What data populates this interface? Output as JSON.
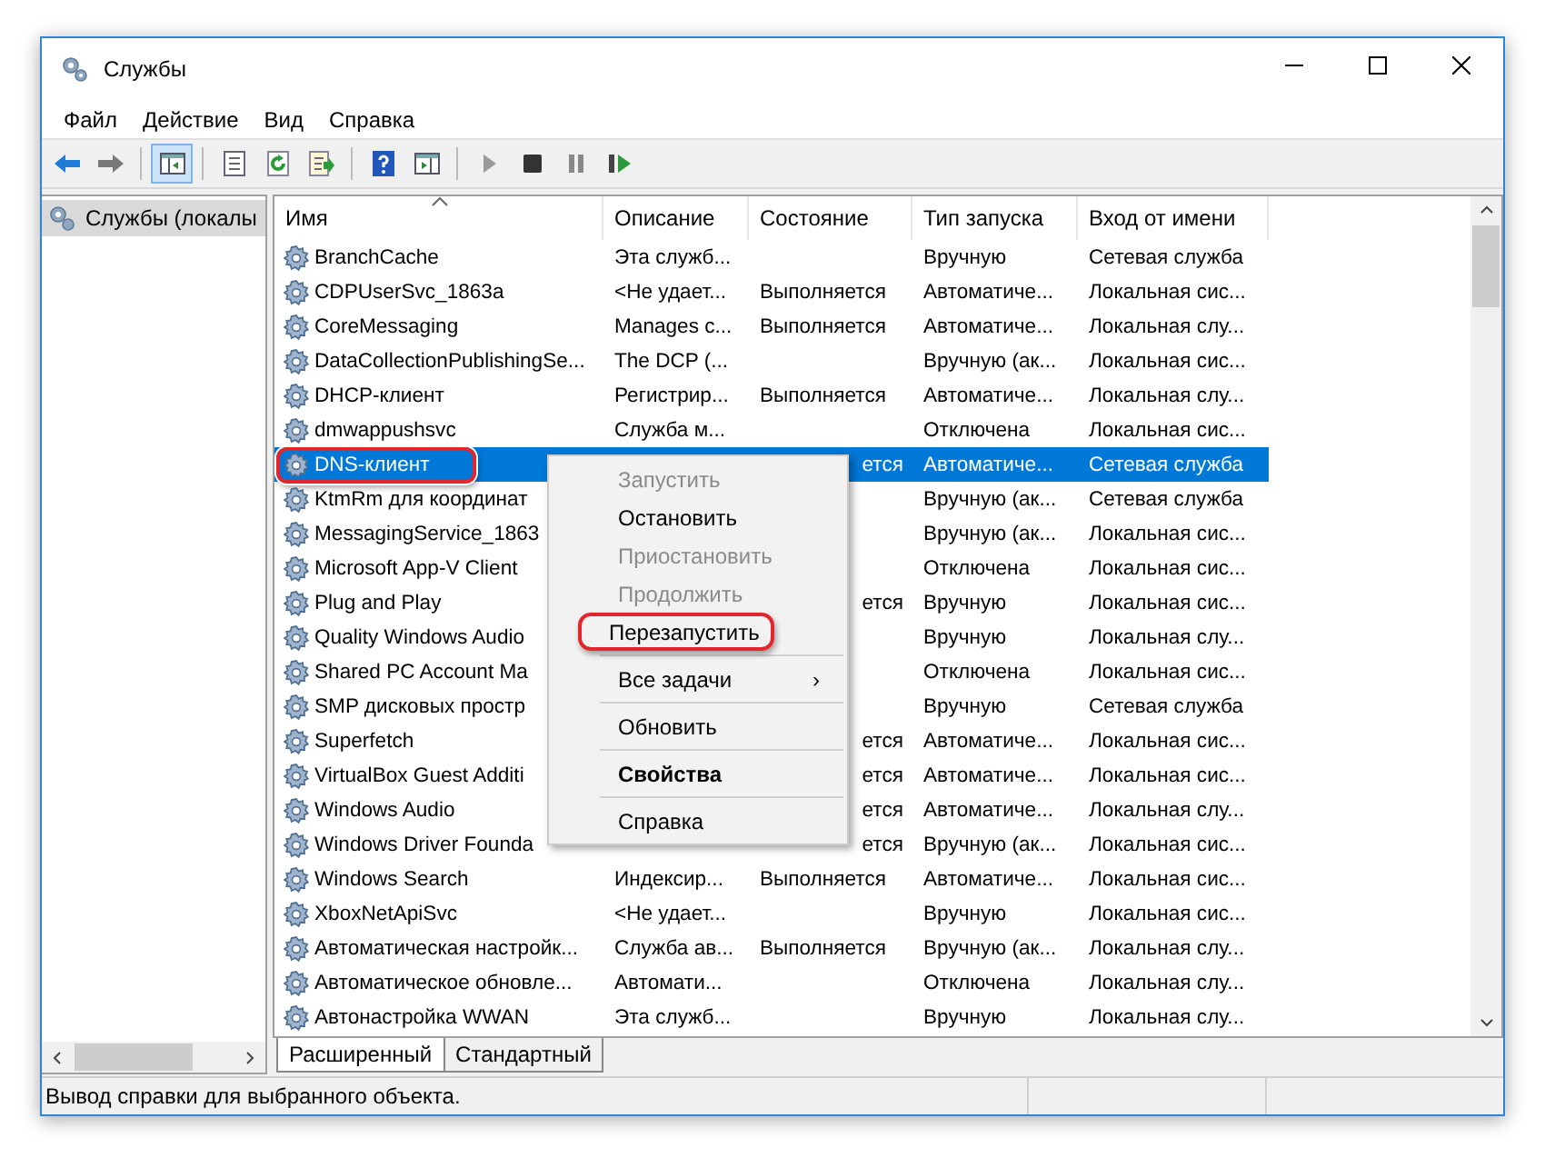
{
  "window": {
    "title": "Службы"
  },
  "menu": [
    "Файл",
    "Действие",
    "Вид",
    "Справка"
  ],
  "toolbar": [
    {
      "buttons": [
        {
          "kind": "back",
          "pressed": false
        },
        {
          "kind": "forward",
          "pressed": false
        }
      ]
    },
    {
      "buttons": [
        {
          "kind": "console-tree",
          "pressed": true
        }
      ]
    },
    {
      "buttons": [
        {
          "kind": "properties",
          "pressed": false
        },
        {
          "kind": "refresh",
          "pressed": false
        },
        {
          "kind": "export",
          "pressed": false
        }
      ]
    },
    {
      "buttons": [
        {
          "kind": "help",
          "pressed": false
        },
        {
          "kind": "action-pane",
          "pressed": false
        }
      ]
    },
    {
      "buttons": [
        {
          "kind": "play",
          "pressed": false
        },
        {
          "kind": "stop",
          "pressed": false
        },
        {
          "kind": "pause",
          "pressed": false
        },
        {
          "kind": "restart",
          "pressed": false
        }
      ]
    }
  ],
  "tree": {
    "items": [
      {
        "label": "Службы (локалы",
        "selected": true
      }
    ]
  },
  "table": {
    "columns": [
      "Имя",
      "Описание",
      "Состояние",
      "Тип запуска",
      "Вход от имени"
    ],
    "rows": [
      {
        "name": "BranchCache",
        "description": "Эта служб...",
        "startup": "Вручную",
        "logon": "Сетевая служба",
        "selected": false,
        "marked": false
      },
      {
        "name": "CDPUserSvc_1863a",
        "description": "<Не удает...",
        "state": "Выполняется",
        "startup": "Автоматиче...",
        "logon": "Локальная сис...",
        "selected": false,
        "covered": false,
        "marked": false
      },
      {
        "name": "CoreMessaging",
        "description": "Manages c...",
        "state": "Выполняется",
        "startup": "Автоматиче...",
        "logon": "Локальная слу...",
        "selected": false,
        "covered": false,
        "marked": false
      },
      {
        "name": "DataCollectionPublishingSe...",
        "description": "The DCP (...",
        "startup": "Вручную (ак...",
        "logon": "Локальная сис...",
        "selected": false,
        "marked": false
      },
      {
        "name": "DHCP-клиент",
        "description": "Регистрир...",
        "state": "Выполняется",
        "startup": "Автоматиче...",
        "logon": "Локальная слу...",
        "selected": false,
        "covered": false,
        "marked": false
      },
      {
        "name": "dmwappushsvc",
        "description": "Служба м...",
        "startup": "Отключена",
        "logon": "Локальная сис...",
        "selected": false,
        "marked": false
      },
      {
        "name": "DNS-клиент",
        "state": "ется",
        "startup": "Автоматиче...",
        "logon": "Сетевая служба",
        "selected": true,
        "covered": true,
        "marked": true
      },
      {
        "name": "KtmRm для координат",
        "startup": "Вручную (ак...",
        "logon": "Сетевая служба",
        "selected": false,
        "marked": false
      },
      {
        "name": "MessagingService_1863",
        "startup": "Вручную (ак...",
        "logon": "Локальная сис...",
        "selected": false,
        "marked": false
      },
      {
        "name": "Microsoft App-V Client",
        "startup": "Отключена",
        "logon": "Локальная сис...",
        "selected": false,
        "marked": false
      },
      {
        "name": "Plug and Play",
        "state": "ется",
        "startup": "Вручную",
        "logon": "Локальная сис...",
        "selected": false,
        "covered": true,
        "marked": false
      },
      {
        "name": "Quality Windows Audio",
        "startup": "Вручную",
        "logon": "Локальная слу...",
        "selected": false,
        "marked": false
      },
      {
        "name": "Shared PC Account Ma",
        "startup": "Отключена",
        "logon": "Локальная сис...",
        "selected": false,
        "marked": false
      },
      {
        "name": "SMP дисковых простр",
        "startup": "Вручную",
        "logon": "Сетевая служба",
        "selected": false,
        "marked": false
      },
      {
        "name": "Superfetch",
        "state": "ется",
        "startup": "Автоматиче...",
        "logon": "Локальная сис...",
        "selected": false,
        "covered": true,
        "marked": false
      },
      {
        "name": "VirtualBox Guest Additi",
        "state": "ется",
        "startup": "Автоматиче...",
        "logon": "Локальная сис...",
        "selected": false,
        "covered": true,
        "marked": false
      },
      {
        "name": "Windows Audio",
        "state": "ется",
        "startup": "Автоматиче...",
        "logon": "Локальная слу...",
        "selected": false,
        "covered": true,
        "marked": false
      },
      {
        "name": "Windows Driver Founda",
        "state": "ется",
        "startup": "Вручную (ак...",
        "logon": "Локальная сис...",
        "selected": false,
        "covered": true,
        "marked": false
      },
      {
        "name": "Windows Search",
        "description": "Индексир...",
        "state": "Выполняется",
        "startup": "Автоматиче...",
        "logon": "Локальная сис...",
        "selected": false,
        "covered": false,
        "marked": false
      },
      {
        "name": "XboxNetApiSvc",
        "description": "<Не удает...",
        "startup": "Вручную",
        "logon": "Локальная сис...",
        "selected": false,
        "marked": false
      },
      {
        "name": "Автоматическая настройк...",
        "description": "Служба ав...",
        "state": "Выполняется",
        "startup": "Вручную (ак...",
        "logon": "Локальная слу...",
        "selected": false,
        "covered": false,
        "marked": false
      },
      {
        "name": "Автоматическое обновле...",
        "description": "Автомати...",
        "startup": "Отключена",
        "logon": "Локальная слу...",
        "selected": false,
        "marked": false
      },
      {
        "name": "Автонастройка WWAN",
        "description": "Эта служб...",
        "startup": "Вручную",
        "logon": "Локальная слу...",
        "selected": false,
        "marked": false
      }
    ]
  },
  "context_menu": {
    "items": [
      {
        "kind": "item",
        "label": "Запустить",
        "disabled": true,
        "bold": false,
        "marked": false
      },
      {
        "kind": "item",
        "label": "Остановить",
        "disabled": false,
        "bold": false,
        "marked": false
      },
      {
        "kind": "item",
        "label": "Приостановить",
        "disabled": true,
        "bold": false,
        "marked": false
      },
      {
        "kind": "item",
        "label": "Продолжить",
        "disabled": true,
        "bold": false,
        "marked": false
      },
      {
        "kind": "item",
        "label": "Перезапустить",
        "disabled": false,
        "bold": false,
        "marked": true
      },
      {
        "kind": "separator"
      },
      {
        "kind": "item",
        "label": "Все задачи",
        "submenu": "›",
        "disabled": false,
        "bold": false,
        "marked": false
      },
      {
        "kind": "separator"
      },
      {
        "kind": "item",
        "label": "Обновить",
        "disabled": false,
        "bold": false,
        "marked": false
      },
      {
        "kind": "separator"
      },
      {
        "kind": "item",
        "label": "Свойства",
        "disabled": false,
        "bold": true,
        "marked": false
      },
      {
        "kind": "separator"
      },
      {
        "kind": "item",
        "label": "Справка",
        "disabled": false,
        "bold": false,
        "marked": false
      }
    ]
  },
  "view_tabs": [
    {
      "label": "Расширенный",
      "selected": true
    },
    {
      "label": "Стандартный",
      "selected": false
    }
  ],
  "status_bar": {
    "text": "Вывод справки для выбранного объекта."
  }
}
